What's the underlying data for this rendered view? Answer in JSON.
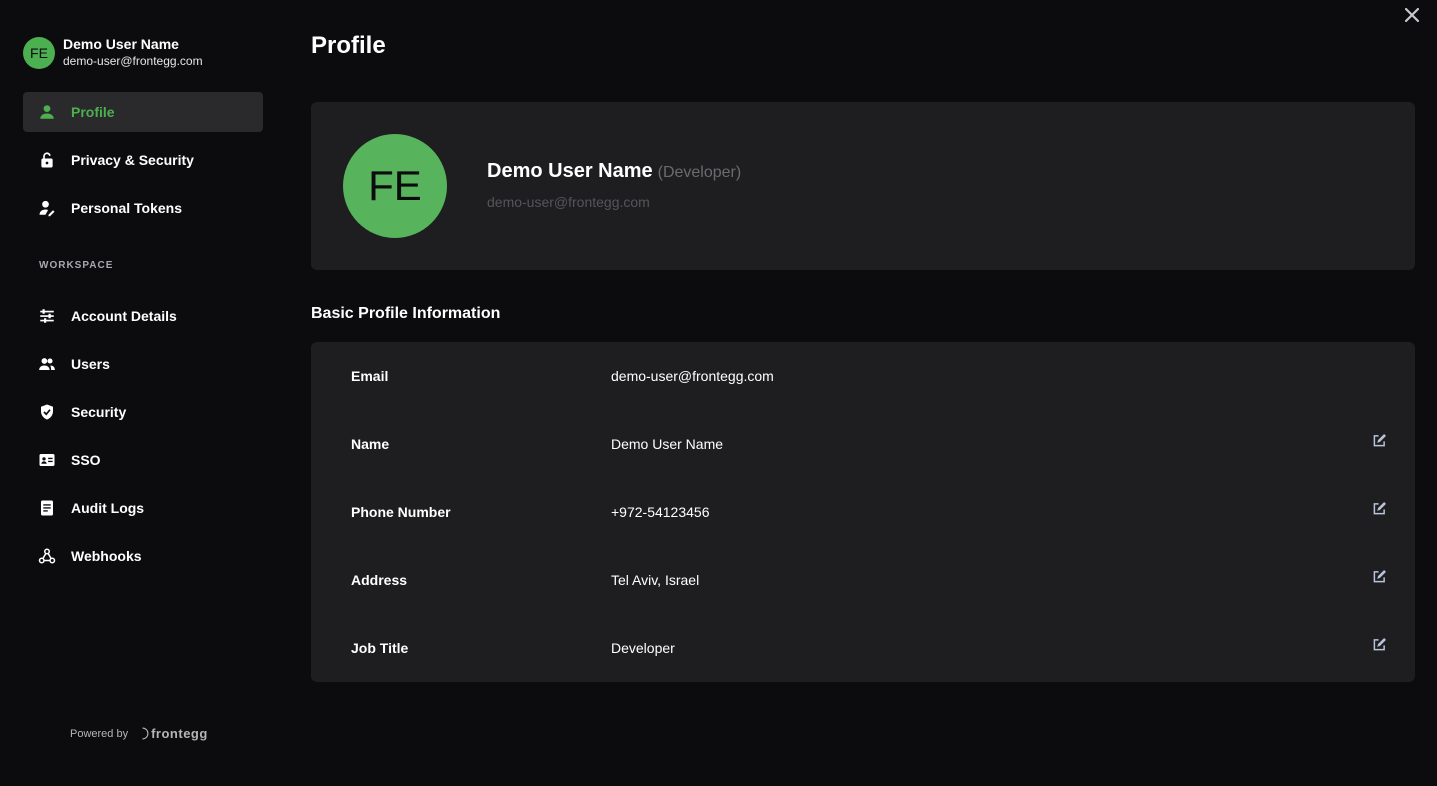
{
  "user": {
    "initials": "FE",
    "name": "Demo User Name",
    "email": "demo-user@frontegg.com"
  },
  "sidebar": {
    "personal_items": [
      {
        "label": "Profile",
        "icon": "person-icon",
        "active": true
      },
      {
        "label": "Privacy & Security",
        "icon": "lock-icon",
        "active": false
      },
      {
        "label": "Personal Tokens",
        "icon": "user-key-icon",
        "active": false
      }
    ],
    "workspace_title": "WORKSPACE",
    "workspace_items": [
      {
        "label": "Account Details",
        "icon": "sliders-icon"
      },
      {
        "label": "Users",
        "icon": "users-icon"
      },
      {
        "label": "Security",
        "icon": "shield-check-icon"
      },
      {
        "label": "SSO",
        "icon": "id-card-icon"
      },
      {
        "label": "Audit Logs",
        "icon": "document-icon"
      },
      {
        "label": "Webhooks",
        "icon": "webhook-icon"
      }
    ],
    "powered_by": "Powered by",
    "brand": "frontegg"
  },
  "main": {
    "title": "Profile",
    "card": {
      "initials": "FE",
      "name": "Demo User Name",
      "role": "(Developer)",
      "email": "demo-user@frontegg.com"
    },
    "section_title": "Basic Profile Information",
    "fields": [
      {
        "label": "Email",
        "value": "demo-user@frontegg.com",
        "editable": false
      },
      {
        "label": "Name",
        "value": "Demo User Name",
        "editable": true
      },
      {
        "label": "Phone Number",
        "value": "+972-54123456",
        "editable": true
      },
      {
        "label": "Address",
        "value": "Tel Aviv, Israel",
        "editable": true
      },
      {
        "label": "Job Title",
        "value": "Developer",
        "editable": true
      }
    ]
  },
  "colors": {
    "accent": "#4caf50",
    "background": "#0c0c0e",
    "card": "#1e1e20",
    "active_nav": "#2a2a2c"
  }
}
